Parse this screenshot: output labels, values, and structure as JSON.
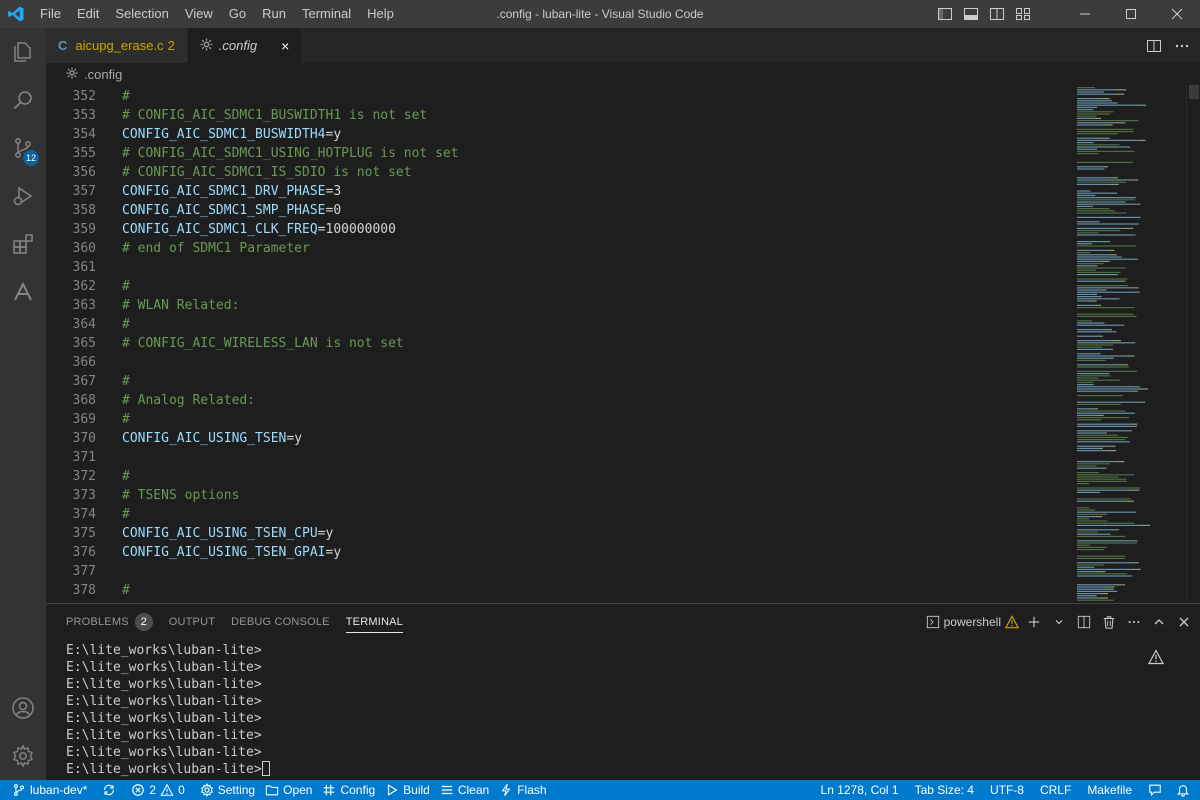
{
  "window": {
    "title": ".config - luban-lite - Visual Studio Code",
    "menu": [
      "File",
      "Edit",
      "Selection",
      "View",
      "Go",
      "Run",
      "Terminal",
      "Help"
    ]
  },
  "activity": {
    "scm_badge": "12"
  },
  "tabs": [
    {
      "label": "aicupg_erase.c",
      "count": "2"
    },
    {
      "label": ".config",
      "close": "×"
    }
  ],
  "breadcrumb": ".config",
  "editor": {
    "lines": [
      {
        "n": "352",
        "t": "comment",
        "text": "#"
      },
      {
        "n": "353",
        "t": "comment",
        "text": "# CONFIG_AIC_SDMC1_BUSWIDTH1 is not set"
      },
      {
        "n": "354",
        "t": "kv",
        "key": "CONFIG_AIC_SDMC1_BUSWIDTH4",
        "val": "y"
      },
      {
        "n": "355",
        "t": "comment",
        "text": "# CONFIG_AIC_SDMC1_USING_HOTPLUG is not set"
      },
      {
        "n": "356",
        "t": "comment",
        "text": "# CONFIG_AIC_SDMC1_IS_SDIO is not set"
      },
      {
        "n": "357",
        "t": "kv",
        "key": "CONFIG_AIC_SDMC1_DRV_PHASE",
        "val": "3"
      },
      {
        "n": "358",
        "t": "kv",
        "key": "CONFIG_AIC_SDMC1_SMP_PHASE",
        "val": "0"
      },
      {
        "n": "359",
        "t": "kv",
        "key": "CONFIG_AIC_SDMC1_CLK_FREQ",
        "val": "100000000"
      },
      {
        "n": "360",
        "t": "comment",
        "text": "# end of SDMC1 Parameter"
      },
      {
        "n": "361",
        "t": "empty",
        "text": ""
      },
      {
        "n": "362",
        "t": "comment",
        "text": "#"
      },
      {
        "n": "363",
        "t": "comment",
        "text": "# WLAN Related:"
      },
      {
        "n": "364",
        "t": "comment",
        "text": "#"
      },
      {
        "n": "365",
        "t": "comment",
        "text": "# CONFIG_AIC_WIRELESS_LAN is not set"
      },
      {
        "n": "366",
        "t": "empty",
        "text": ""
      },
      {
        "n": "367",
        "t": "comment",
        "text": "#"
      },
      {
        "n": "368",
        "t": "comment",
        "text": "# Analog Related:"
      },
      {
        "n": "369",
        "t": "comment",
        "text": "#"
      },
      {
        "n": "370",
        "t": "kv",
        "key": "CONFIG_AIC_USING_TSEN",
        "val": "y"
      },
      {
        "n": "371",
        "t": "empty",
        "text": ""
      },
      {
        "n": "372",
        "t": "comment",
        "text": "#"
      },
      {
        "n": "373",
        "t": "comment",
        "text": "# TSENS options"
      },
      {
        "n": "374",
        "t": "comment",
        "text": "#"
      },
      {
        "n": "375",
        "t": "kv",
        "key": "CONFIG_AIC_USING_TSEN_CPU",
        "val": "y"
      },
      {
        "n": "376",
        "t": "kv",
        "key": "CONFIG_AIC_USING_TSEN_GPAI",
        "val": "y"
      },
      {
        "n": "377",
        "t": "empty",
        "text": ""
      },
      {
        "n": "378",
        "t": "comment",
        "text": "#"
      }
    ]
  },
  "panel": {
    "tabs": [
      {
        "label": "PROBLEMS",
        "count": "2"
      },
      {
        "label": "OUTPUT"
      },
      {
        "label": "DEBUG CONSOLE"
      },
      {
        "label": "TERMINAL",
        "active": true
      }
    ],
    "terminal_name": "powershell",
    "terminal_lines": [
      "E:\\lite_works\\luban-lite>",
      "E:\\lite_works\\luban-lite>",
      "E:\\lite_works\\luban-lite>",
      "E:\\lite_works\\luban-lite>",
      "E:\\lite_works\\luban-lite>",
      "E:\\lite_works\\luban-lite>",
      "E:\\lite_works\\luban-lite>",
      "E:\\lite_works\\luban-lite>"
    ]
  },
  "status": {
    "branch": "luban-dev*",
    "errors": "2",
    "warnings": "0",
    "setting": "Setting",
    "open": "Open",
    "config": "Config",
    "build": "Build",
    "clean": "Clean",
    "flash": "Flash",
    "position": "Ln 1278, Col 1",
    "tab_size": "Tab Size: 4",
    "encoding": "UTF-8",
    "eol": "CRLF",
    "language": "Makefile"
  },
  "colors": {
    "accent": "#007acc",
    "warning": "#cca700",
    "comment": "#6a9955",
    "key": "#9cdcfe"
  }
}
